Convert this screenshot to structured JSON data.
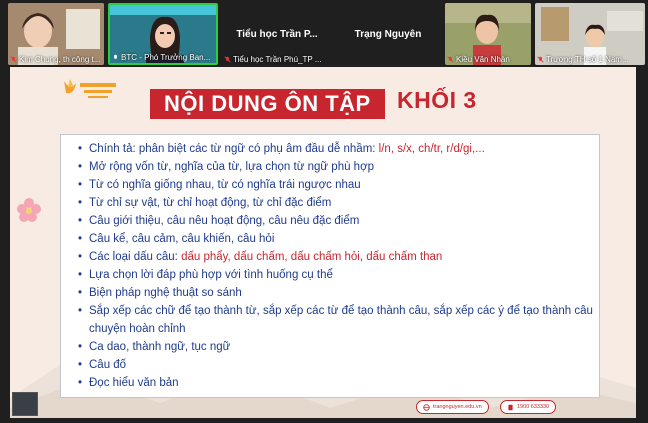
{
  "participants": [
    {
      "name": "Kim Chung, th công t...",
      "type": "video"
    },
    {
      "name": "BTC - Phó Trưởng Ban...",
      "type": "video",
      "active": true
    },
    {
      "name": "Tiểu học Trần Phú_TP ...",
      "label": "Tiểu học Trần P...",
      "type": "name"
    },
    {
      "name": "Trạng Nguyên",
      "label": "Trạng Nguyên",
      "type": "name"
    },
    {
      "name": "Kiều Văn Nhàn",
      "type": "video"
    },
    {
      "name": "Trương TH số 1 Nam...",
      "type": "video"
    }
  ],
  "slide": {
    "title": "NỘI DUNG ÔN TẬP",
    "grade": "KHỐI 3",
    "items": [
      {
        "text": "Chính tả: phân biệt các từ ngữ có phụ âm đầu dễ nhầm: ",
        "highlight": "l/n, s/x, ch/tr, r/d/gi,..."
      },
      {
        "text": "Mở rộng vốn từ, nghĩa của từ, lựa chọn từ ngữ phù hợp"
      },
      {
        "text": "Từ có nghĩa giống nhau, từ có nghĩa trái ngược nhau"
      },
      {
        "text": "Từ chỉ sự vật, từ chỉ hoạt động, từ chỉ đặc điểm"
      },
      {
        "text": "Câu giới thiệu, câu nêu hoạt động, câu nêu đặc điểm"
      },
      {
        "text": "Câu kể, câu cảm, câu khiến, câu hỏi"
      },
      {
        "text": "Các loại dấu câu: ",
        "highlight": "dấu phẩy, dấu chấm, dấu chấm hỏi, dấu chấm than"
      },
      {
        "text": "Lựa chọn lời đáp phù hợp với tình huống cụ thể"
      },
      {
        "text": "Biện pháp nghệ thuật so sánh"
      },
      {
        "text": "Sắp xếp các chữ để tạo thành từ, sắp xếp các từ để tạo thành câu, sắp xếp các ý để tạo thành câu chuyện hoàn chỉnh"
      },
      {
        "text": "Ca dao, thành ngữ, tục ngữ"
      },
      {
        "text": "Câu đố"
      },
      {
        "text": "Đọc hiểu văn bản"
      }
    ],
    "footer": {
      "website": "trangnguyen.edu.vn",
      "phone": "1900 633330"
    }
  }
}
